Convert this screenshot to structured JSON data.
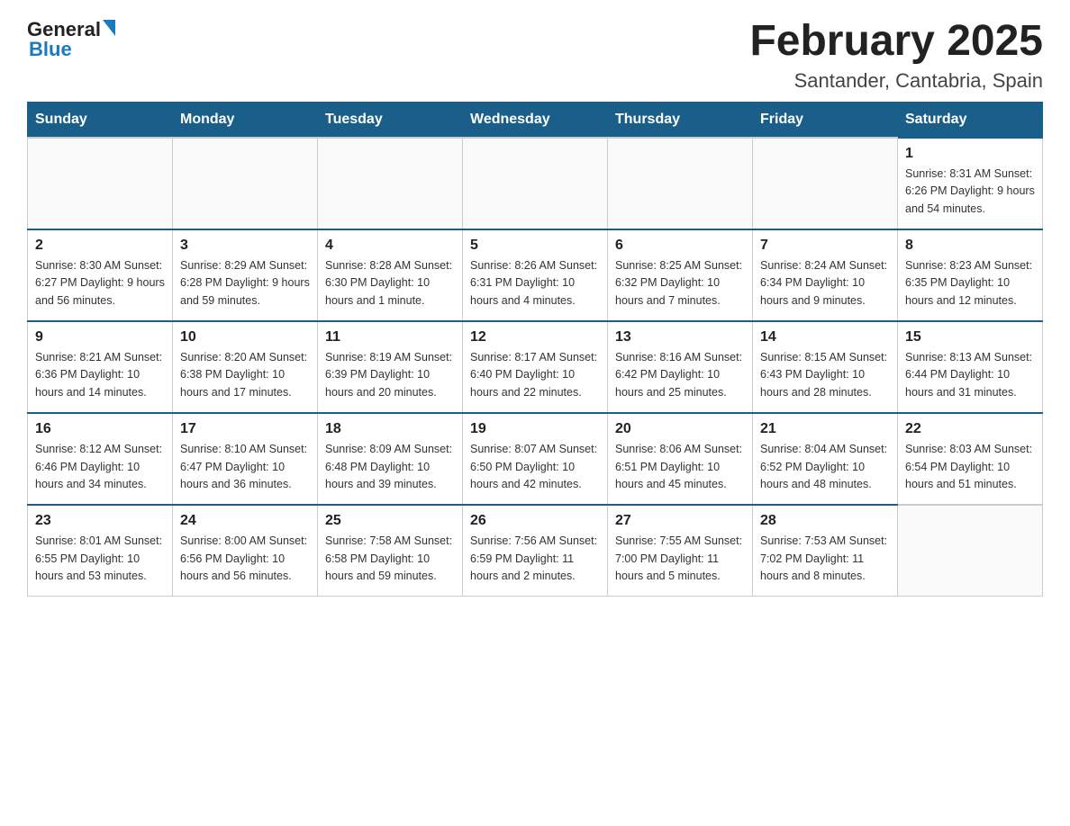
{
  "header": {
    "title": "February 2025",
    "location": "Santander, Cantabria, Spain",
    "logo_general": "General",
    "logo_blue": "Blue"
  },
  "days_of_week": [
    "Sunday",
    "Monday",
    "Tuesday",
    "Wednesday",
    "Thursday",
    "Friday",
    "Saturday"
  ],
  "weeks": [
    [
      {
        "day": "",
        "info": ""
      },
      {
        "day": "",
        "info": ""
      },
      {
        "day": "",
        "info": ""
      },
      {
        "day": "",
        "info": ""
      },
      {
        "day": "",
        "info": ""
      },
      {
        "day": "",
        "info": ""
      },
      {
        "day": "1",
        "info": "Sunrise: 8:31 AM\nSunset: 6:26 PM\nDaylight: 9 hours and 54 minutes."
      }
    ],
    [
      {
        "day": "2",
        "info": "Sunrise: 8:30 AM\nSunset: 6:27 PM\nDaylight: 9 hours and 56 minutes."
      },
      {
        "day": "3",
        "info": "Sunrise: 8:29 AM\nSunset: 6:28 PM\nDaylight: 9 hours and 59 minutes."
      },
      {
        "day": "4",
        "info": "Sunrise: 8:28 AM\nSunset: 6:30 PM\nDaylight: 10 hours and 1 minute."
      },
      {
        "day": "5",
        "info": "Sunrise: 8:26 AM\nSunset: 6:31 PM\nDaylight: 10 hours and 4 minutes."
      },
      {
        "day": "6",
        "info": "Sunrise: 8:25 AM\nSunset: 6:32 PM\nDaylight: 10 hours and 7 minutes."
      },
      {
        "day": "7",
        "info": "Sunrise: 8:24 AM\nSunset: 6:34 PM\nDaylight: 10 hours and 9 minutes."
      },
      {
        "day": "8",
        "info": "Sunrise: 8:23 AM\nSunset: 6:35 PM\nDaylight: 10 hours and 12 minutes."
      }
    ],
    [
      {
        "day": "9",
        "info": "Sunrise: 8:21 AM\nSunset: 6:36 PM\nDaylight: 10 hours and 14 minutes."
      },
      {
        "day": "10",
        "info": "Sunrise: 8:20 AM\nSunset: 6:38 PM\nDaylight: 10 hours and 17 minutes."
      },
      {
        "day": "11",
        "info": "Sunrise: 8:19 AM\nSunset: 6:39 PM\nDaylight: 10 hours and 20 minutes."
      },
      {
        "day": "12",
        "info": "Sunrise: 8:17 AM\nSunset: 6:40 PM\nDaylight: 10 hours and 22 minutes."
      },
      {
        "day": "13",
        "info": "Sunrise: 8:16 AM\nSunset: 6:42 PM\nDaylight: 10 hours and 25 minutes."
      },
      {
        "day": "14",
        "info": "Sunrise: 8:15 AM\nSunset: 6:43 PM\nDaylight: 10 hours and 28 minutes."
      },
      {
        "day": "15",
        "info": "Sunrise: 8:13 AM\nSunset: 6:44 PM\nDaylight: 10 hours and 31 minutes."
      }
    ],
    [
      {
        "day": "16",
        "info": "Sunrise: 8:12 AM\nSunset: 6:46 PM\nDaylight: 10 hours and 34 minutes."
      },
      {
        "day": "17",
        "info": "Sunrise: 8:10 AM\nSunset: 6:47 PM\nDaylight: 10 hours and 36 minutes."
      },
      {
        "day": "18",
        "info": "Sunrise: 8:09 AM\nSunset: 6:48 PM\nDaylight: 10 hours and 39 minutes."
      },
      {
        "day": "19",
        "info": "Sunrise: 8:07 AM\nSunset: 6:50 PM\nDaylight: 10 hours and 42 minutes."
      },
      {
        "day": "20",
        "info": "Sunrise: 8:06 AM\nSunset: 6:51 PM\nDaylight: 10 hours and 45 minutes."
      },
      {
        "day": "21",
        "info": "Sunrise: 8:04 AM\nSunset: 6:52 PM\nDaylight: 10 hours and 48 minutes."
      },
      {
        "day": "22",
        "info": "Sunrise: 8:03 AM\nSunset: 6:54 PM\nDaylight: 10 hours and 51 minutes."
      }
    ],
    [
      {
        "day": "23",
        "info": "Sunrise: 8:01 AM\nSunset: 6:55 PM\nDaylight: 10 hours and 53 minutes."
      },
      {
        "day": "24",
        "info": "Sunrise: 8:00 AM\nSunset: 6:56 PM\nDaylight: 10 hours and 56 minutes."
      },
      {
        "day": "25",
        "info": "Sunrise: 7:58 AM\nSunset: 6:58 PM\nDaylight: 10 hours and 59 minutes."
      },
      {
        "day": "26",
        "info": "Sunrise: 7:56 AM\nSunset: 6:59 PM\nDaylight: 11 hours and 2 minutes."
      },
      {
        "day": "27",
        "info": "Sunrise: 7:55 AM\nSunset: 7:00 PM\nDaylight: 11 hours and 5 minutes."
      },
      {
        "day": "28",
        "info": "Sunrise: 7:53 AM\nSunset: 7:02 PM\nDaylight: 11 hours and 8 minutes."
      },
      {
        "day": "",
        "info": ""
      }
    ]
  ]
}
